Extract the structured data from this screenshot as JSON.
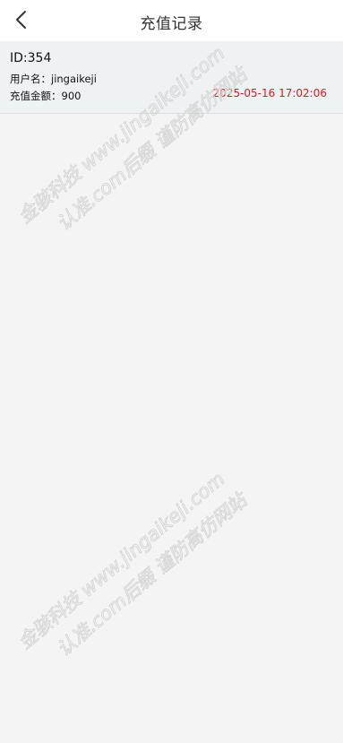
{
  "header": {
    "back_icon": "chevron-left-icon",
    "title": "充值记录"
  },
  "record": {
    "id": "ID:354",
    "username_label": "用户名：",
    "username": "jingaikeji",
    "amount_label": "充值金额：",
    "amount": "900",
    "time": "2025-05-16 17:02:06"
  },
  "watermark": {
    "line1": "金骇科技 www.jingaikeji.com",
    "line2": "认准.com后缀 谨防高仿网站"
  },
  "colors": {
    "page_background": "#f4f4f4",
    "header_background": "#ffffff",
    "card_background": "#eef2f3",
    "time_text": "#e5141b"
  }
}
